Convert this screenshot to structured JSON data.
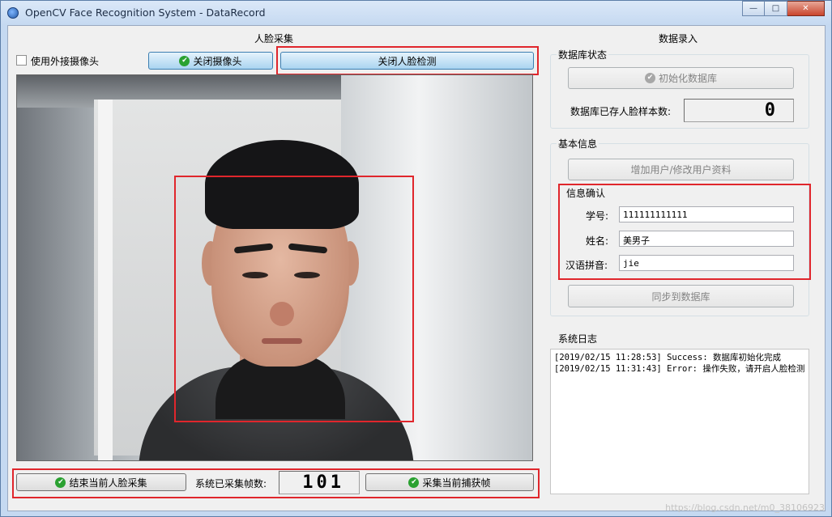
{
  "window": {
    "title": "OpenCV Face Recognition System - DataRecord",
    "minimize_glyph": "—",
    "maximize_glyph": "□",
    "close_glyph": "✕"
  },
  "left": {
    "section_title": "人脸采集",
    "external_camera_label": "使用外接摄像头",
    "close_camera_label": "关闭摄像头",
    "close_face_detect_label": "关闭人脸检测",
    "end_capture_label": "结束当前人脸采集",
    "frames_label": "系统已采集帧数:",
    "frames_count": "101",
    "capture_frame_label": "采集当前捕获帧"
  },
  "right": {
    "section_title": "数据录入",
    "db_status": {
      "group_label": "数据库状态",
      "init_db_label": "初始化数据库",
      "sample_count_label": "数据库已存人脸样本数:",
      "sample_count": "0"
    },
    "basic_info": {
      "group_label": "基本信息",
      "add_user_label": "增加用户/修改用户资料",
      "confirm": {
        "group_label": "信息确认",
        "student_id_label": "学号:",
        "student_id_value": "111111111111",
        "name_label": "姓名:",
        "name_value": "美男子",
        "pinyin_label": "汉语拼音:",
        "pinyin_value": "jie"
      },
      "sync_label": "同步到数据库"
    },
    "log": {
      "group_label": "系统日志",
      "lines": [
        "[2019/02/15 11:28:53] Success: 数据库初始化完成",
        "[2019/02/15 11:31:43] Error: 操作失败，请开启人脸检测"
      ]
    }
  },
  "watermark": "https://blog.csdn.net/m0_38106923",
  "colors": {
    "highlight_red": "#e0262c",
    "success_green": "#2aa131"
  },
  "icons": {
    "check": "✔"
  }
}
